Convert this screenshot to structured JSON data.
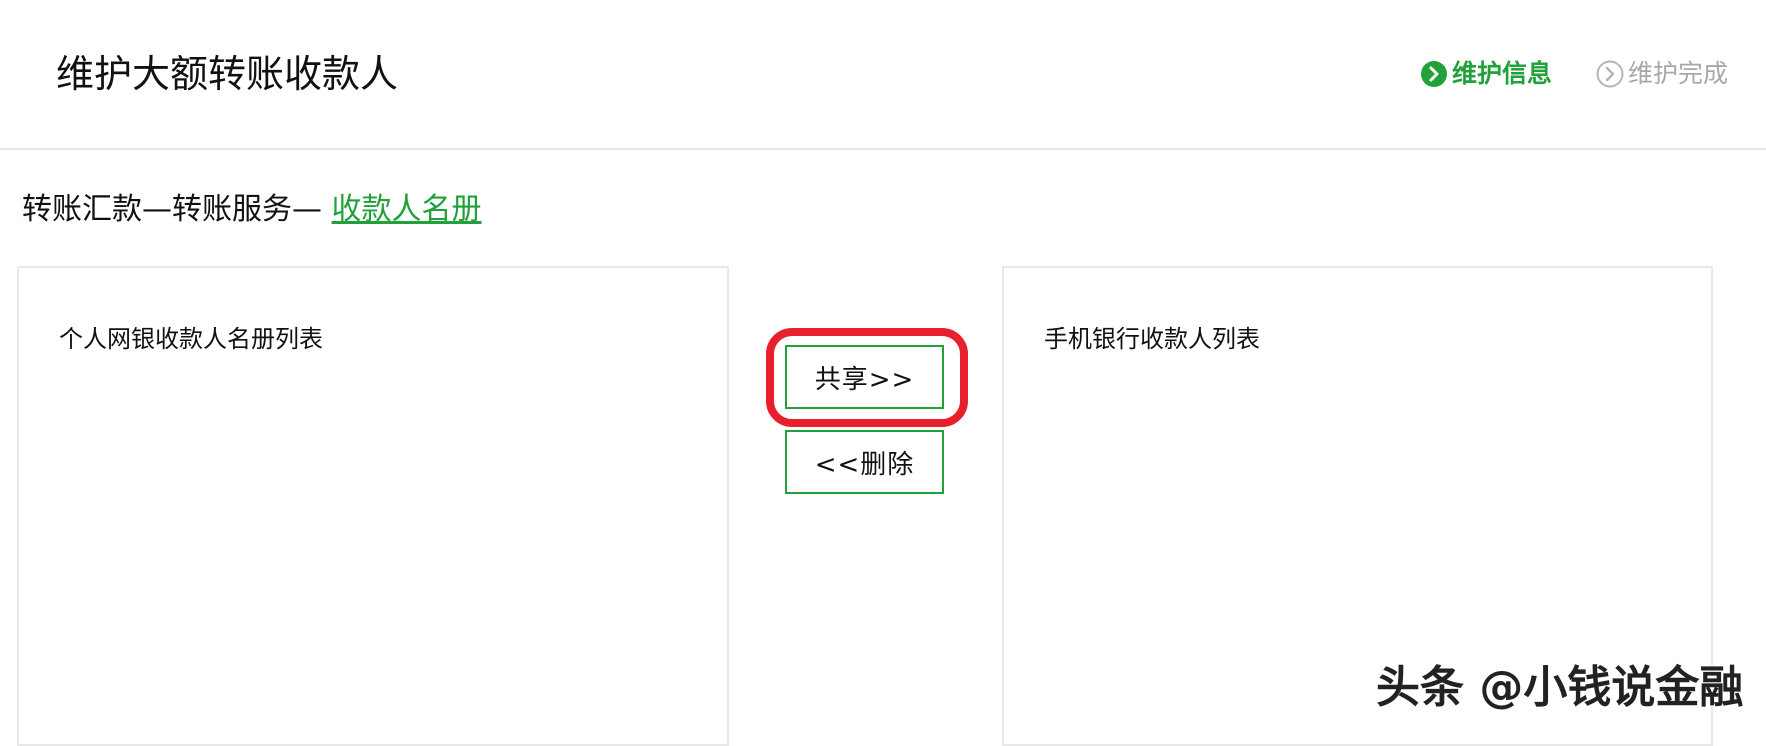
{
  "header": {
    "title": "维护大额转账收款人",
    "steps": [
      {
        "label": "维护信息",
        "state": "active",
        "icon": "chevron-right-circle-icon",
        "color": "#22a13a"
      },
      {
        "label": "维护完成",
        "state": "inactive",
        "icon": "chevron-right-circle-outline-icon",
        "color": "#a8a8a8"
      }
    ]
  },
  "breadcrumb": {
    "path_text": "转账汇款—转账服务— ",
    "link_label": "收款人名册",
    "link_color": "#22a13a"
  },
  "left_panel": {
    "title": "个人网银收款人名册列表"
  },
  "actions": {
    "share_label": "共享>>",
    "delete_label": "<<删除",
    "highlight_color": "#e8202b",
    "border_color": "#22a13a"
  },
  "right_panel": {
    "title": "手机银行收款人列表"
  },
  "watermark": {
    "text": "头条 @小钱说金融"
  }
}
